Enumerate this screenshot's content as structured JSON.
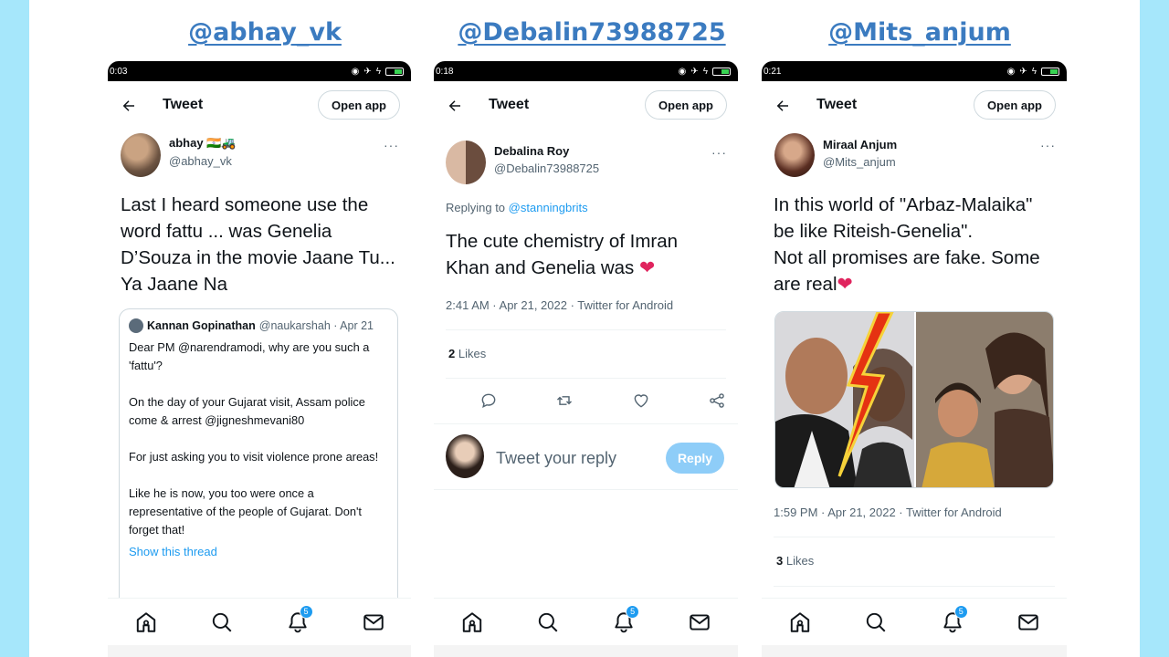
{
  "titles": [
    "@abhay_vk",
    "@Debalin73988725",
    "@Mits_anjum"
  ],
  "phones": [
    {
      "status_time": "0:03",
      "header_title": "Tweet",
      "open_app": "Open app",
      "author_name": "abhay 🇮🇳🚜",
      "author_handle": "@abhay_vk",
      "tweet_text": "Last I heard someone use the word fattu ... was Genelia D’Souza in the movie Jaane Tu... Ya Jaane Na",
      "quote": {
        "name": "Kannan Gopinathan",
        "handle": "@naukarshah · Apr 21",
        "paragraphs": [
          "Dear PM @narendramodi, why are you such a 'fattu'?",
          "On the day of your Gujarat visit, Assam police come & arrest @jigneshmevani80",
          "For just asking you to visit violence prone areas!",
          "Like he is now, you too were once a representative of the people of Gujarat. Don't forget that!"
        ],
        "show_thread": "Show this thread"
      },
      "badge_count": "5"
    },
    {
      "status_time": "0:18",
      "header_title": "Tweet",
      "open_app": "Open app",
      "author_name": "Debalina Roy",
      "author_handle": "@Debalin73988725",
      "replying_label": "Replying to",
      "replying_to": "@stanningbrits",
      "tweet_text": "The cute chemistry of Imran Khan and Genelia was",
      "meta": "2:41 AM · Apr 21, 2022 · Twitter for Android",
      "likes_count": "2",
      "likes_label": "Likes",
      "reply_placeholder": "Tweet your reply",
      "reply_button": "Reply",
      "badge_count": "5"
    },
    {
      "status_time": "0:21",
      "header_title": "Tweet",
      "open_app": "Open app",
      "author_name": "Miraal Anjum",
      "author_handle": "@Mits_anjum",
      "tweet_text_1": "In this world of \"Arbaz-Malaika\" be like Riteish-Genelia\".",
      "tweet_text_2": "Not all promises are fake. Some are real",
      "meta": "1:59 PM · Apr 21, 2022 · Twitter for Android",
      "likes_count": "3",
      "likes_label": "Likes",
      "badge_count": "5"
    }
  ],
  "heart": "❤",
  "more": "···",
  "colors": {
    "background": "#a6e7fb",
    "handle": "#3b7bc0",
    "accent": "#1d9bf0",
    "reply_button": "#8ecdf8"
  }
}
